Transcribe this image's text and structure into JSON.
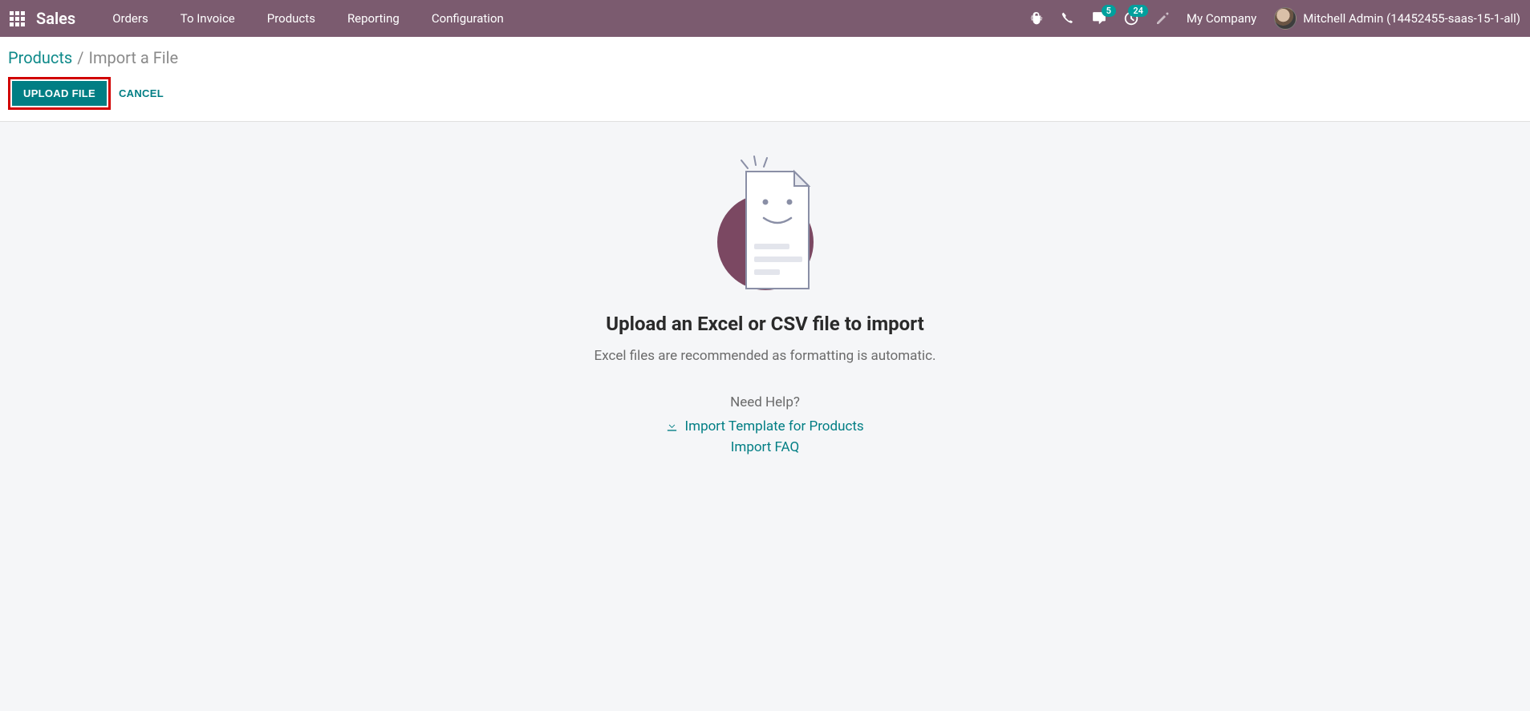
{
  "navbar": {
    "brand": "Sales",
    "menu": [
      "Orders",
      "To Invoice",
      "Products",
      "Reporting",
      "Configuration"
    ],
    "badges": {
      "messages": "5",
      "activities": "24"
    },
    "company": "My Company",
    "username": "Mitchell Admin (14452455-saas-15-1-all)"
  },
  "breadcrumb": {
    "link": "Products",
    "sep": "/",
    "current": "Import a File"
  },
  "actions": {
    "upload": "Upload File",
    "cancel": "Cancel"
  },
  "content": {
    "heading": "Upload an Excel or CSV file to import",
    "subtitle": "Excel files are recommended as formatting is automatic.",
    "help_label": "Need Help?",
    "template_link": "Import Template for Products",
    "faq_link": "Import FAQ"
  }
}
